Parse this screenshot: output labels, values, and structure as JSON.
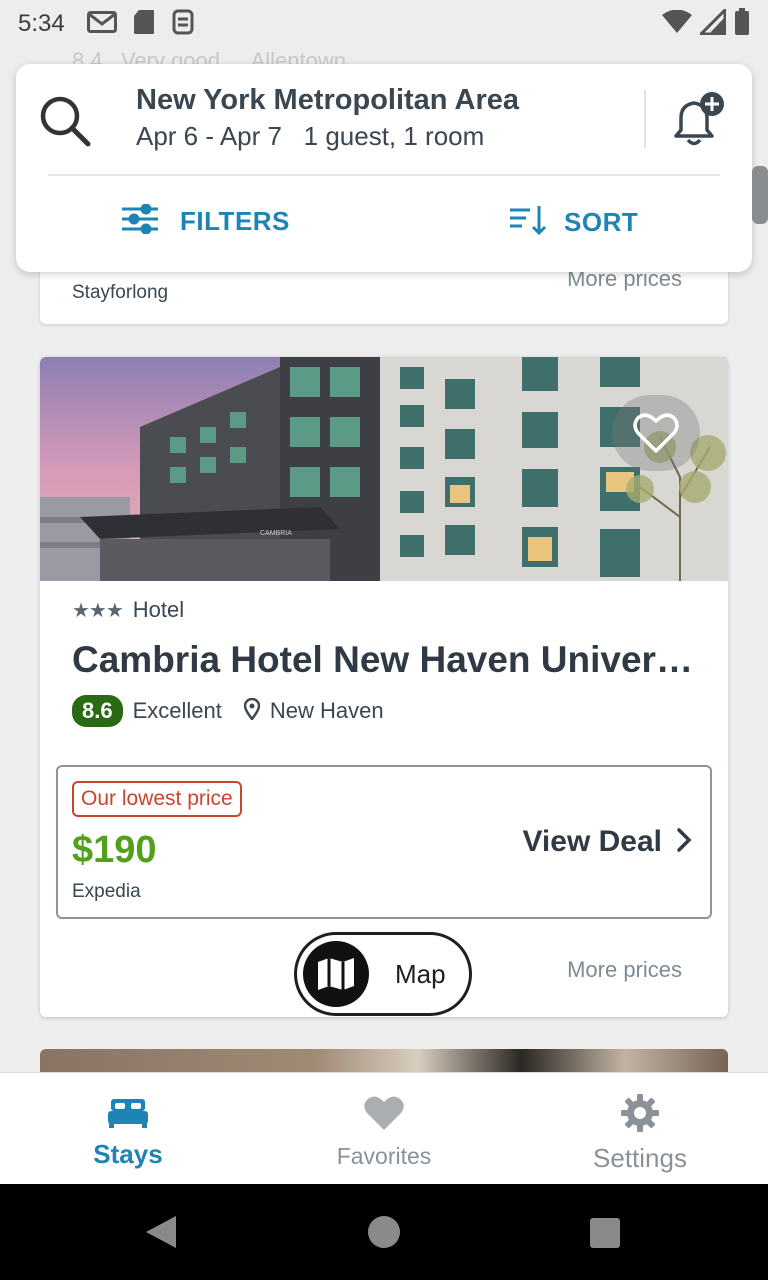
{
  "status_bar": {
    "time": "5:34",
    "left_icons": [
      "gmail-icon",
      "sd-card-icon",
      "sync-icon"
    ],
    "right_icons": [
      "wifi-icon",
      "signal-icon",
      "battery-icon"
    ]
  },
  "background_partial": {
    "rating_hint": "8.4",
    "rating_text": "Very good",
    "location": "Allentown"
  },
  "search": {
    "location": "New York Metropolitan Area",
    "dates": "Apr 6 - Apr 7",
    "guests": "1 guest, 1 room",
    "filters_label": "FILTERS",
    "sort_label": "SORT"
  },
  "previous_card": {
    "provider": "Stayforlong",
    "more_prices": "More prices"
  },
  "hotel": {
    "stars": "★★★",
    "type": "Hotel",
    "name": "Cambria Hotel New Haven University",
    "rating": "8.6",
    "rating_text": "Excellent",
    "location": "New Haven",
    "deal_tag": "Our lowest price",
    "price": "$190",
    "provider": "Expedia",
    "view_deal_label": "View Deal",
    "more_prices": "More prices",
    "sign_text": "CAMBRIA"
  },
  "map_button": {
    "label": "Map"
  },
  "bottom_nav": {
    "stays": "Stays",
    "favorites": "Favorites",
    "settings": "Settings"
  },
  "colors": {
    "accent_blue": "#1e84b6",
    "price_green": "#52a01c",
    "rating_green": "#2b6a14",
    "tag_red": "#c9452c",
    "text_dark": "#2f3a45"
  }
}
